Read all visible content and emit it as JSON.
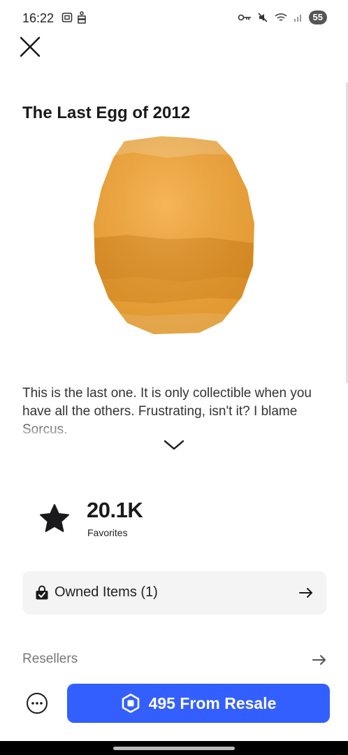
{
  "status_bar": {
    "time": "16:22",
    "battery": "55"
  },
  "item": {
    "title": "The Last Egg of 2012",
    "description": "This is the last one. It is only collectible when you have all the others. Frustrating, isn't it? I blame Sorcus.",
    "image_colors": {
      "light": "#f8b85a",
      "main": "#f5a431",
      "band": "#e08a1a"
    }
  },
  "favorites": {
    "count": "20.1K",
    "label": "Favorites"
  },
  "owned": {
    "label": "Owned Items (1)"
  },
  "resellers": {
    "label": "Resellers"
  },
  "purchase": {
    "label": "495 From Resale",
    "accent": "#335fff"
  },
  "icons": [
    "close-icon",
    "chevron-down-icon",
    "star-icon",
    "lock-bag-icon",
    "arrow-right-icon",
    "more-icon",
    "robux-icon"
  ]
}
